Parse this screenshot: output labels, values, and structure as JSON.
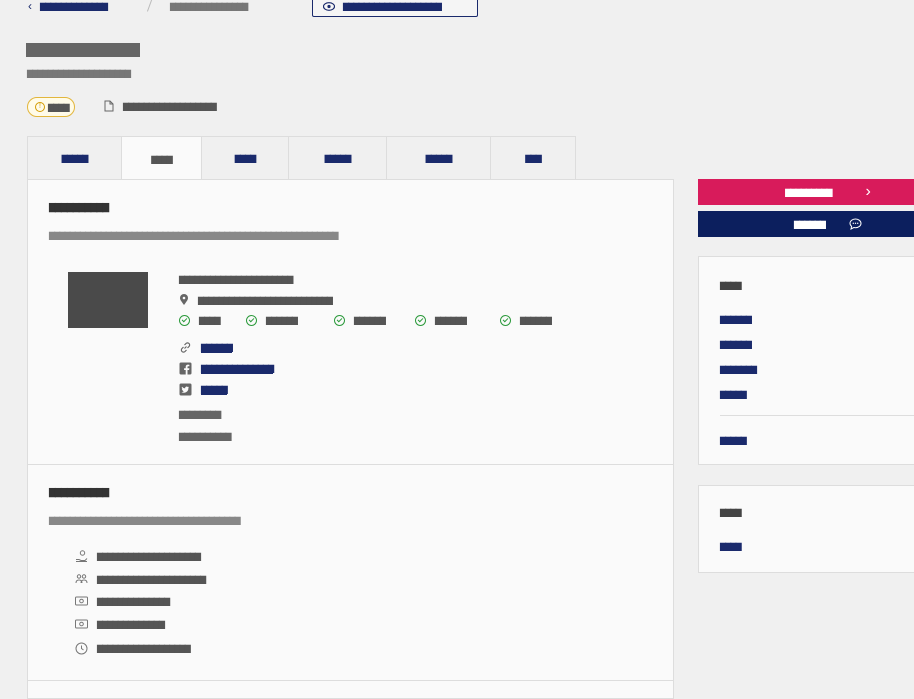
{
  "breadcrumb": {
    "back_label": "▇▇▇▇▇▇▇▇▇▇▇▇▇",
    "current_label": "▇▇▇▇▇▇▇▇▇▇▇▇▇▇▇",
    "preview_label": "▇▇▇▇▇▇▇▇▇▇▇▇▇▇▇▇▇▇▇"
  },
  "header": {
    "title": "▇▇▇▇▇▇▇▇▇▇▇▇",
    "subtitle": "▇▇▇▇▇▇▇▇▇▇▇▇▇▇▇▇▇▇▇▇",
    "status_label": "▇▇▇▇",
    "file_label": "▇▇▇▇▇▇▇▇▇▇▇▇▇▇▇▇▇▇"
  },
  "tabs": [
    {
      "label": "▇▇▇▇▇"
    },
    {
      "label": "▇▇▇▇"
    },
    {
      "label": "▇▇▇▇"
    },
    {
      "label": "▇▇▇▇▇"
    },
    {
      "label": "▇▇▇▇▇"
    },
    {
      "label": "▇▇▇"
    }
  ],
  "overview": {
    "title": "▇▇▇▇▇▇▇▇▇▇",
    "description": "▇▇▇▇▇▇▇▇▇▇▇▇▇▇▇▇▇▇▇▇▇▇▇▇▇▇▇▇▇▇▇▇▇▇▇▇▇▇▇▇▇▇▇▇▇▇▇▇▇▇▇▇▇▇▇▇",
    "org_name": "▇▇▇▇▇▇▇▇▇▇▇▇▇▇▇▇▇▇▇▇▇▇",
    "address": "▇▇▇▇▇▇▇▇▇▇▇▇▇▇▇▇▇▇▇▇▇▇▇▇▇▇",
    "features": [
      "▇▇▇▇",
      "▇▇▇▇▇▇",
      "▇▇▇▇▇▇",
      "▇▇▇▇▇▇",
      "▇▇▇▇▇▇"
    ],
    "website": "▇▇▇▇▇▇",
    "facebook": "▇▇▇▇▇▇▇▇▇▇▇▇▇▇",
    "twitter": "▇▇▇▇▇",
    "contact_label": "▇▇▇▇▇▇▇▇",
    "contact_value": "▇▇▇▇▇▇▇▇▇▇"
  },
  "details": {
    "title": "▇▇▇▇▇▇▇▇▇▇",
    "description": "▇▇▇▇▇▇▇▇▇▇▇▇▇▇▇▇▇▇▇▇▇▇▇▇▇▇▇▇▇▇▇▇▇▇▇▇▇",
    "items": [
      {
        "icon": "hand-coin-icon",
        "text": "▇▇▇▇▇▇▇▇▇▇▇▇▇▇▇▇▇▇▇▇"
      },
      {
        "icon": "people-icon",
        "text": "▇▇▇▇▇▇▇▇▇▇▇▇▇▇▇▇▇▇▇▇▇"
      },
      {
        "icon": "cash-icon",
        "text": "▇▇▇▇▇▇▇▇▇▇▇▇▇▇"
      },
      {
        "icon": "cash-icon",
        "text": "▇▇▇▇▇▇▇▇▇▇▇▇▇"
      },
      {
        "icon": "clock-icon",
        "text": "▇▇▇▇▇▇▇▇▇▇▇▇▇▇▇▇▇▇"
      }
    ]
  },
  "actions": {
    "primary_label": "▇▇▇▇▇▇▇▇▇",
    "secondary_label": "▇▇▇▇▇▇"
  },
  "side_card_1": {
    "title": "▇▇▇▇",
    "links": [
      "▇▇▇▇▇▇",
      "▇▇▇▇▇▇",
      "▇▇▇▇▇▇▇",
      "▇▇▇▇▇"
    ],
    "footer_link": "▇▇▇▇▇"
  },
  "side_card_2": {
    "title": "▇▇▇▇",
    "link": "▇▇▇▇"
  },
  "colors": {
    "accent_primary": "#d81b5b",
    "accent_navy": "#0c1f5e",
    "link": "#1a2a6c",
    "success": "#2c9a3c",
    "warning": "#e2b63c"
  }
}
